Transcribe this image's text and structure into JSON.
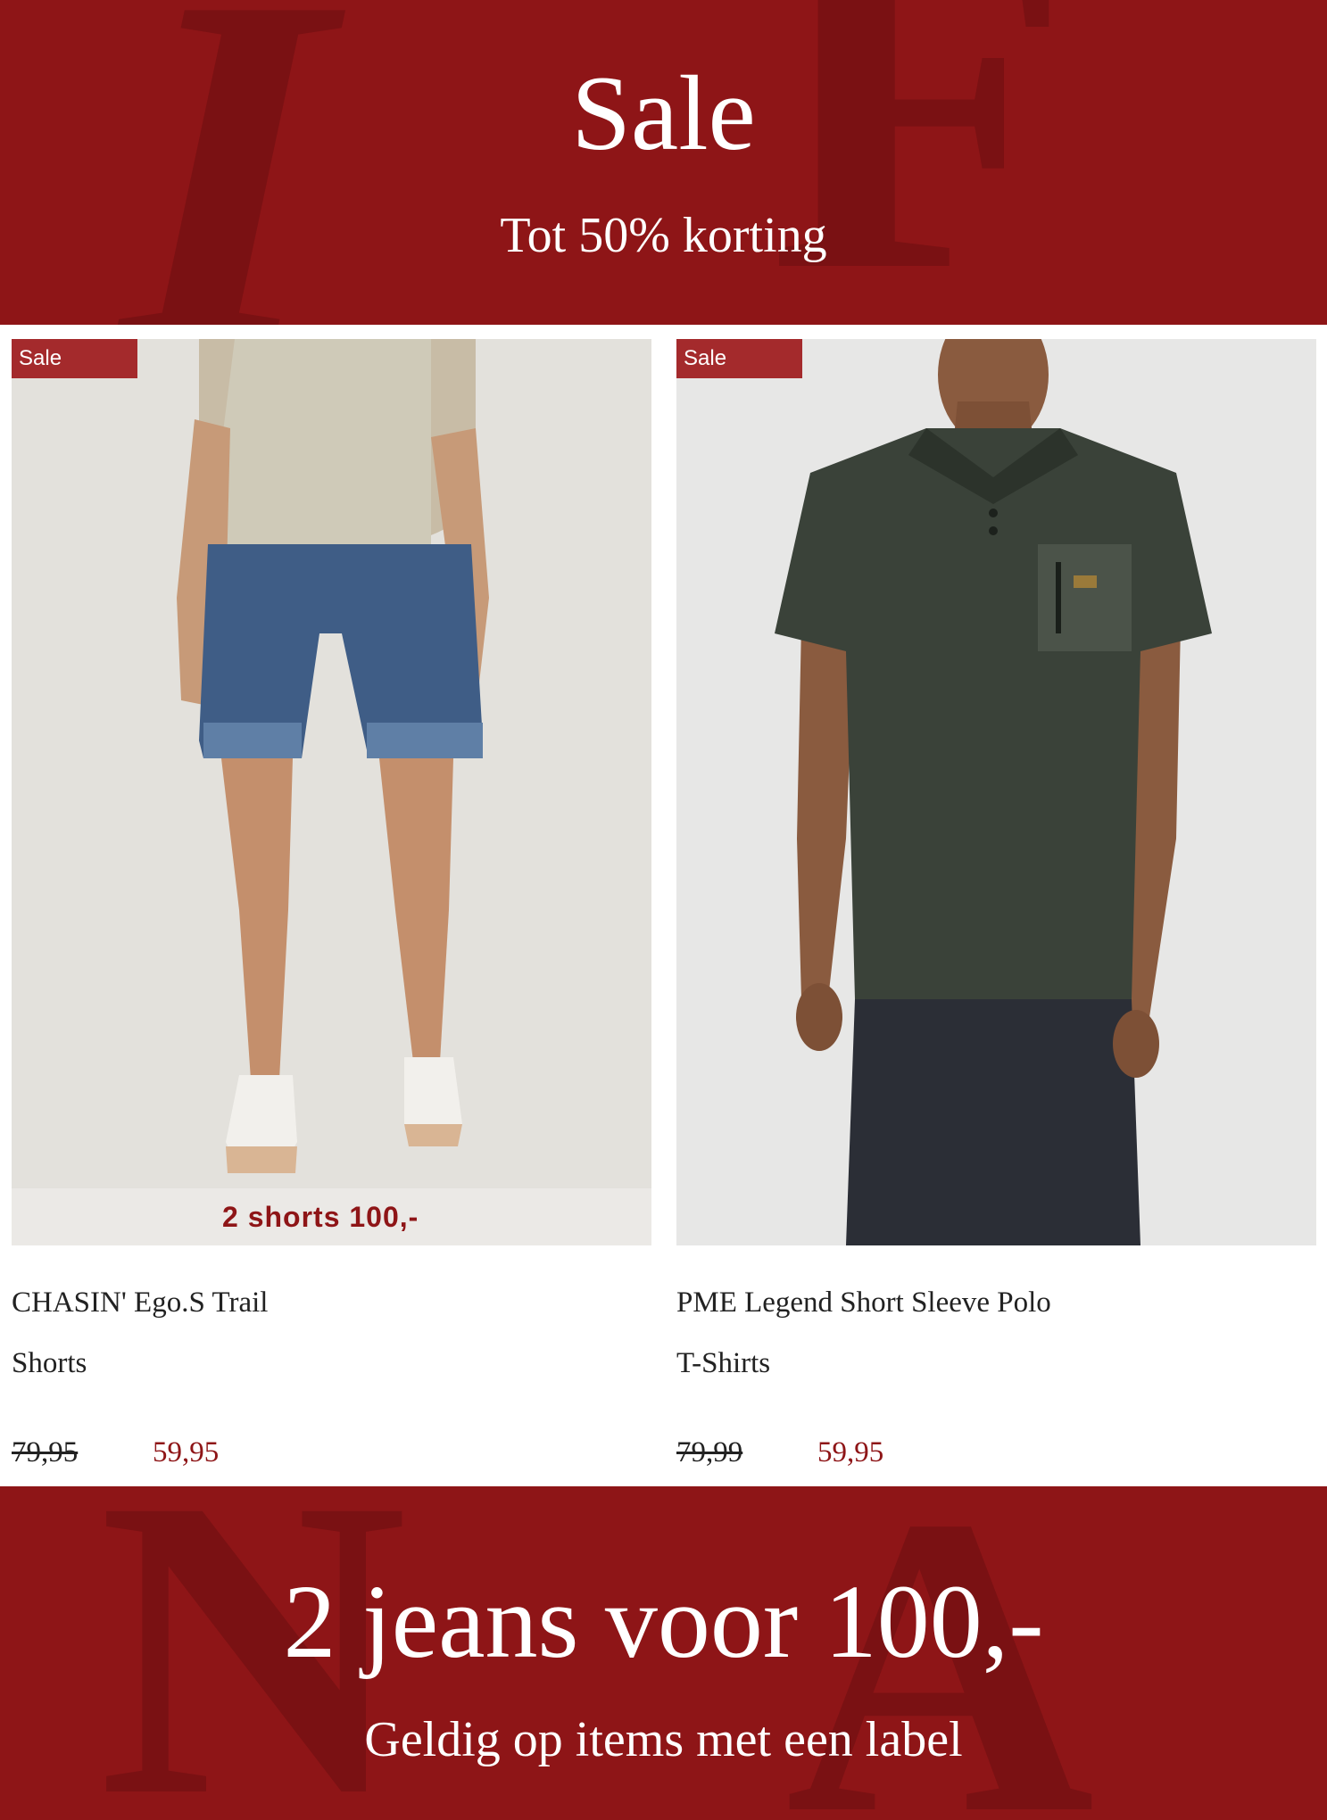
{
  "top_banner": {
    "title": "Sale",
    "subtitle": "Tot 50% korting",
    "background_color": "#8e1517"
  },
  "products": [
    {
      "badge": "Sale",
      "image": "model-wearing-denim-shorts",
      "promo": "2 shorts 100,-",
      "name": "CHASIN' Ego.S Trail",
      "category": "Shorts",
      "old_price": "79,95",
      "new_price": "59,95"
    },
    {
      "badge": "Sale",
      "image": "model-wearing-dark-green-polo",
      "promo": "",
      "name": "PME Legend Short Sleeve Polo",
      "category": "T-Shirts",
      "old_price": "79,99",
      "new_price": "59,95"
    }
  ],
  "bottom_banner": {
    "title": "2 jeans voor 100,-",
    "subtitle": "Geldig op items met een label"
  },
  "colors": {
    "accent": "#8e1517",
    "badge": "#a42a2c"
  }
}
